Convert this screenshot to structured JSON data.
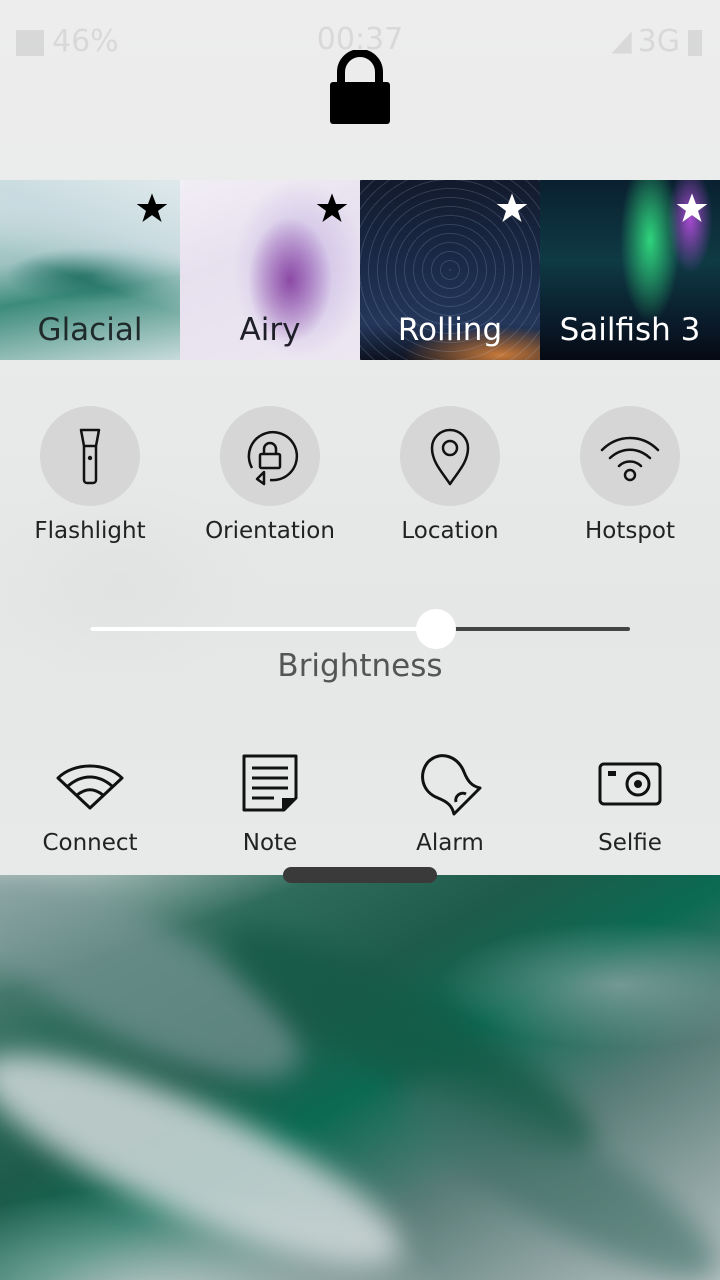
{
  "status_bar": {
    "battery_percent": "46%",
    "time": "00:37",
    "network": "3G"
  },
  "ambiences": [
    {
      "name": "Glacial",
      "favorite": true
    },
    {
      "name": "Airy",
      "favorite": true
    },
    {
      "name": "Rolling",
      "favorite": true
    },
    {
      "name": "Sailfish 3",
      "favorite": true
    }
  ],
  "quick_toggles": [
    {
      "label": "Flashlight",
      "icon": "flashlight-icon"
    },
    {
      "label": "Orientation",
      "icon": "orientation-lock-icon"
    },
    {
      "label": "Location",
      "icon": "location-pin-icon"
    },
    {
      "label": "Hotspot",
      "icon": "hotspot-icon"
    }
  ],
  "brightness": {
    "label": "Brightness",
    "level": 0.64
  },
  "shortcuts": [
    {
      "label": "Connect",
      "icon": "wifi-icon"
    },
    {
      "label": "Note",
      "icon": "note-icon"
    },
    {
      "label": "Alarm",
      "icon": "alarm-bell-icon"
    },
    {
      "label": "Selfie",
      "icon": "camera-icon"
    }
  ]
}
